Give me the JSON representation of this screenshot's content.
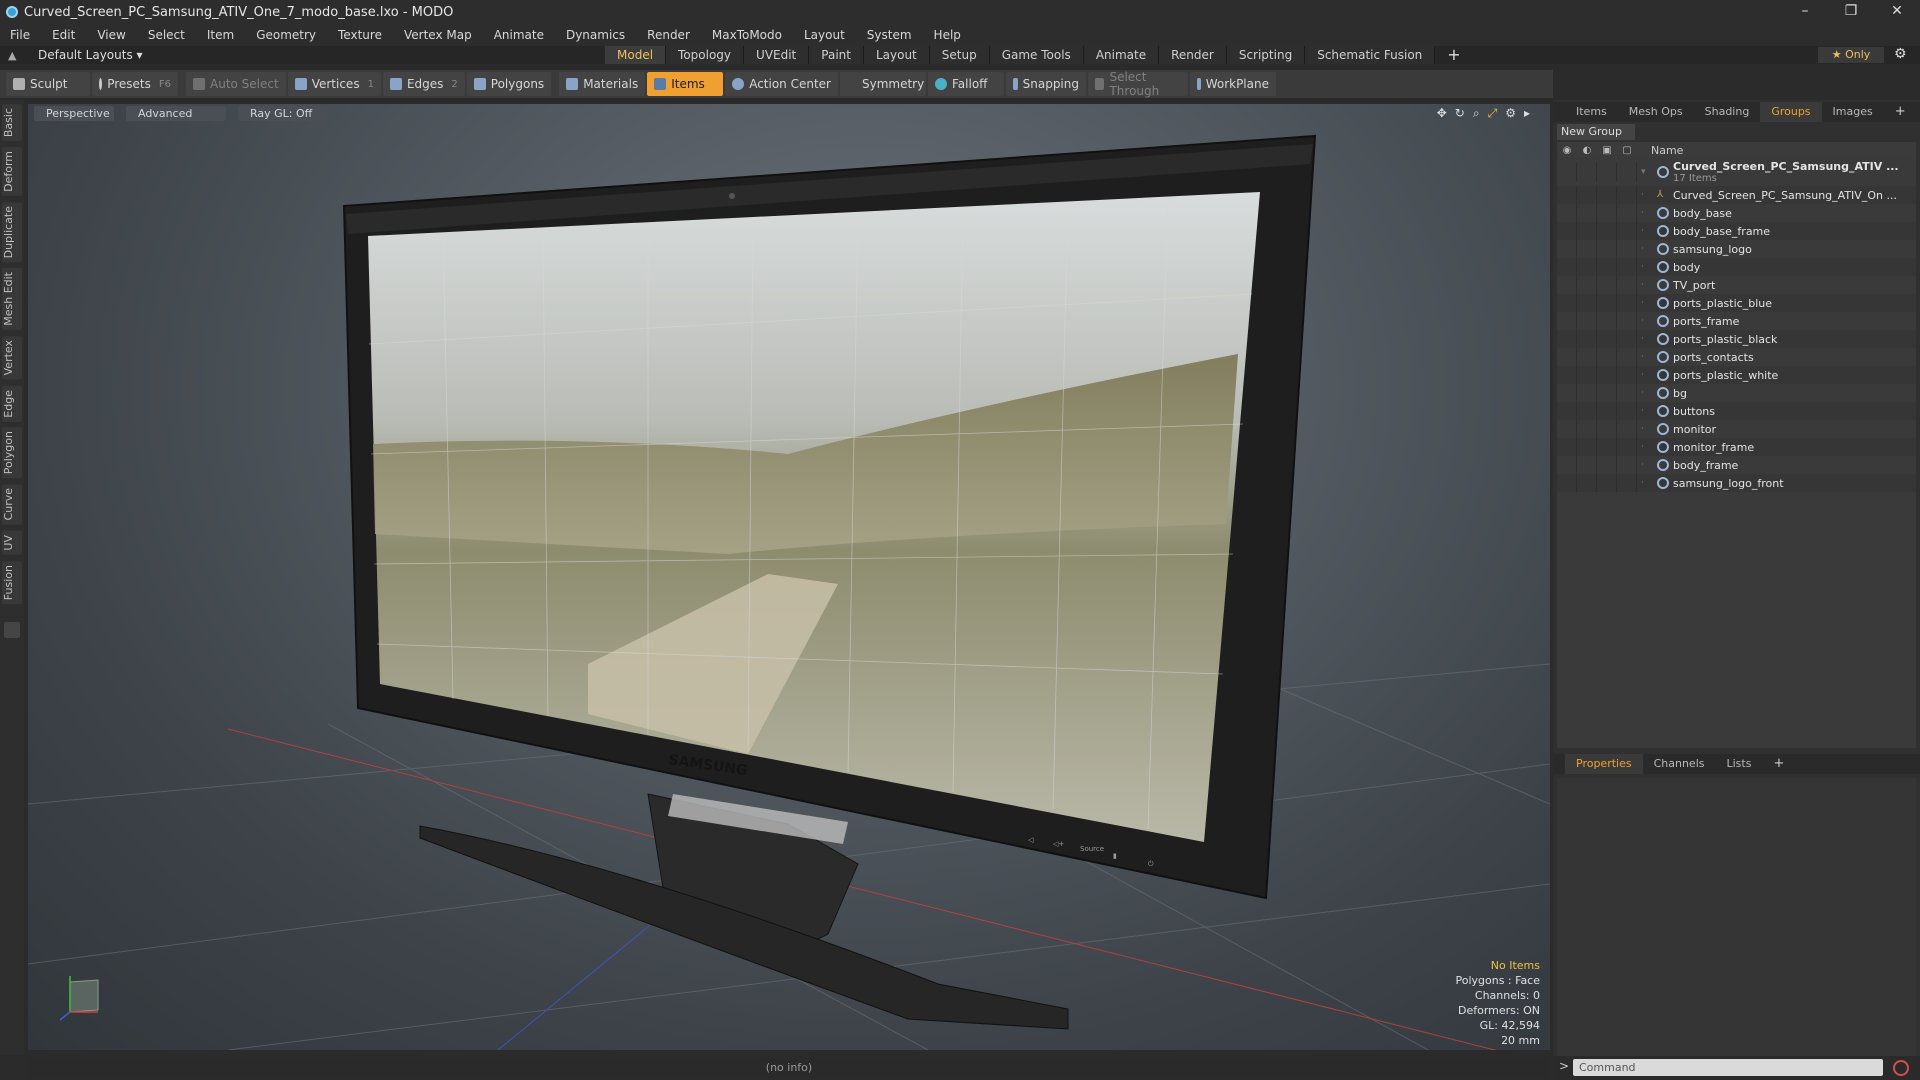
{
  "window": {
    "title": "Curved_Screen_PC_Samsung_ATIV_One_7_modo_base.lxo - MODO",
    "controls": [
      "–",
      "❐",
      "✕"
    ]
  },
  "menu": [
    "File",
    "Edit",
    "View",
    "Select",
    "Item",
    "Geometry",
    "Texture",
    "Vertex Map",
    "Animate",
    "Dynamics",
    "Render",
    "MaxToModo",
    "Layout",
    "System",
    "Help"
  ],
  "layoutbar": {
    "layout_label": "Default Layouts ▾",
    "tabs": [
      "Model",
      "Topology",
      "UVEdit",
      "Paint",
      "Layout",
      "Setup",
      "Game Tools",
      "Animate",
      "Render",
      "Scripting",
      "Schematic Fusion"
    ],
    "active_tab": "Model",
    "plus": "+",
    "only_label": "★  Only"
  },
  "toolbar": {
    "sculpt": "Sculpt",
    "presets": "Presets",
    "presets_key": "F6",
    "auto_select": "Auto Select",
    "vertices": "Vertices",
    "vertices_count": "1",
    "edges": "Edges",
    "edges_count": "2",
    "polygons": "Polygons",
    "materials": "Materials",
    "items": "Items",
    "action_center": "Action Center",
    "symmetry": "Symmetry",
    "falloff": "Falloff",
    "snapping": "Snapping",
    "select_through": "Select Through",
    "workplane": "WorkPlane"
  },
  "left_tabs": [
    "Basic",
    "Deform",
    "Duplicate",
    "Mesh Edit",
    "Vertex",
    "Edge",
    "Polygon",
    "Curve",
    "UV",
    "Fusion"
  ],
  "viewport": {
    "header": [
      "Perspective",
      "Advanced",
      "Ray GL: Off"
    ],
    "stats": {
      "selection": "No Items",
      "polygons": "Polygons : Face",
      "channels": "Channels: 0",
      "deformers": "Deformers: ON",
      "gl": "GL: 42,594",
      "scale": "20 mm"
    },
    "brand_text": "SAMSUNG",
    "screen_buttons": [
      "◁",
      "◁+",
      "Source",
      "▮",
      "⏻"
    ]
  },
  "status": "(no info)",
  "panel_top": {
    "tabs": [
      "Items",
      "Mesh Ops",
      "Shading",
      "Groups",
      "Images"
    ],
    "active_tab": "Groups",
    "new_group": "New Group",
    "name_header": "Name",
    "root": {
      "name": "Curved_Screen_PC_Samsung_ATIV ...",
      "count": "17 Items"
    },
    "items": [
      "Curved_Screen_PC_Samsung_ATIV_On ...",
      "body_base",
      "body_base_frame",
      "samsung_logo",
      "body",
      "TV_port",
      "ports_plastic_blue",
      "ports_frame",
      "ports_plastic_black",
      "ports_contacts",
      "ports_plastic_white",
      "bg",
      "buttons",
      "monitor",
      "monitor_frame",
      "body_frame",
      "samsung_logo_front"
    ]
  },
  "panel_bottom": {
    "tabs": [
      "Properties",
      "Channels",
      "Lists"
    ],
    "active_tab": "Properties"
  },
  "command": {
    "prompt": ">",
    "placeholder": "Command"
  },
  "colors": {
    "accent": "#f0a030",
    "viewport_bg": "#545b62"
  }
}
